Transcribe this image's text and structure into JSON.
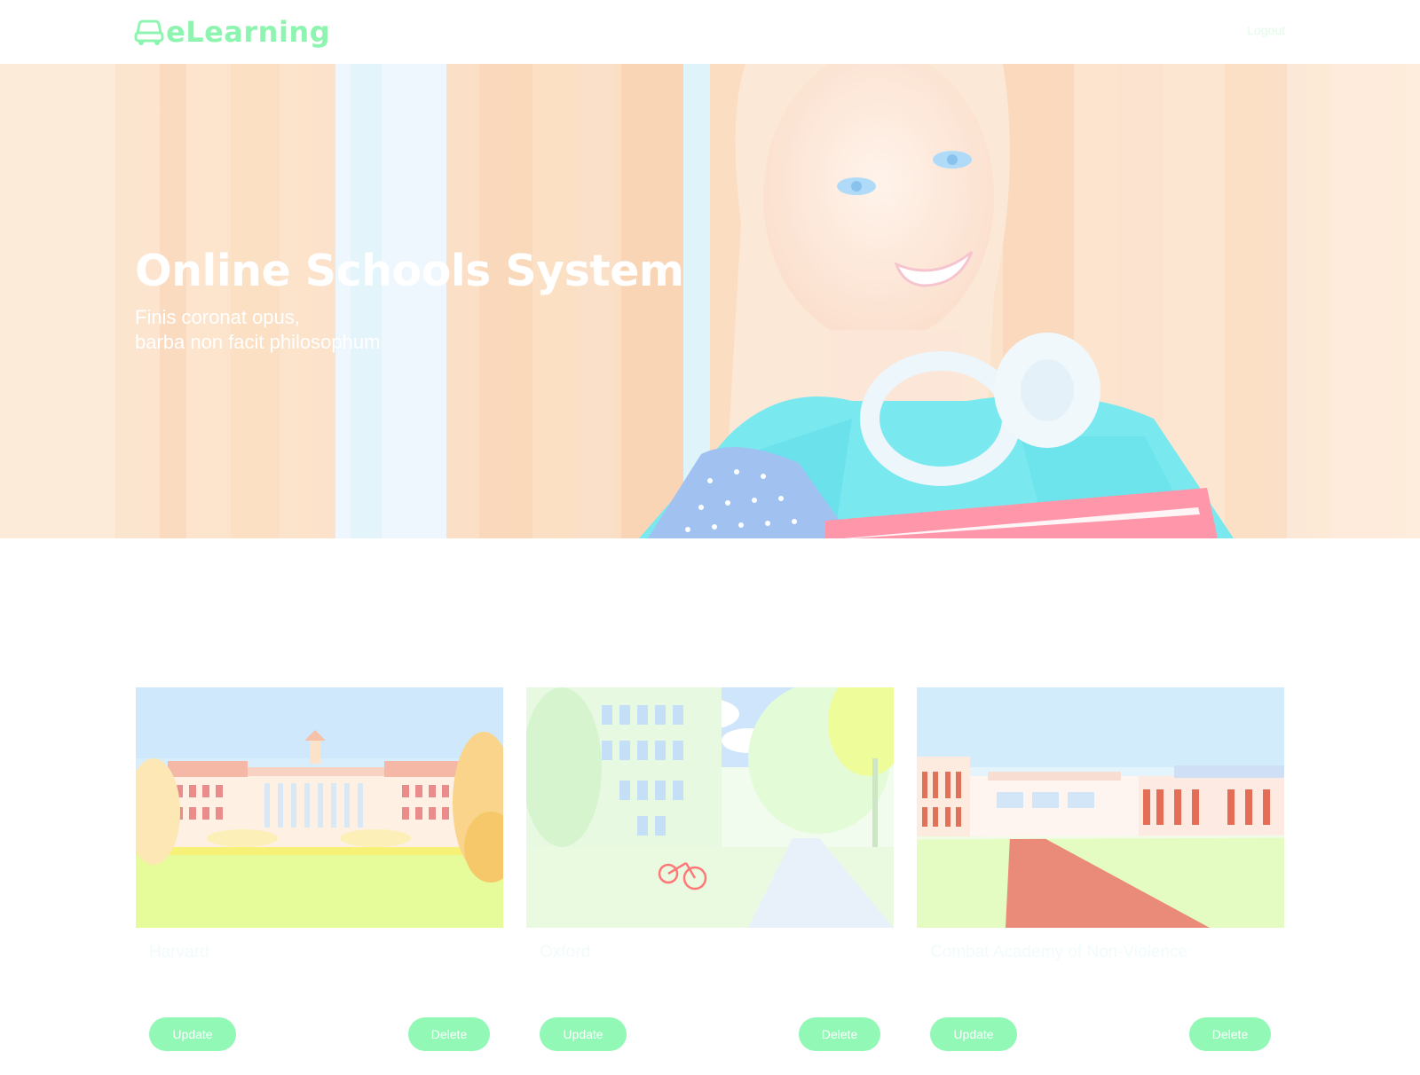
{
  "header": {
    "brand": "eLearning",
    "logout_label": "Logout"
  },
  "hero": {
    "title": "Online Schools System",
    "subtitle_line1": "Finis coronat opus,",
    "subtitle_line2": "barba non facit philosophum"
  },
  "schools": [
    {
      "name": "Harvard",
      "update_label": "Update",
      "delete_label": "Delete"
    },
    {
      "name": "Oxford",
      "update_label": "Update",
      "delete_label": "Delete"
    },
    {
      "name": "Combat Academy of Non-Violence",
      "update_label": "Update",
      "delete_label": "Delete"
    }
  ],
  "icons": {
    "brand_icon": "graduation-cap-icon"
  },
  "colors": {
    "brand": "#8ef5b0",
    "button": "#92f8b5",
    "hero_background": "#fde5cf"
  }
}
